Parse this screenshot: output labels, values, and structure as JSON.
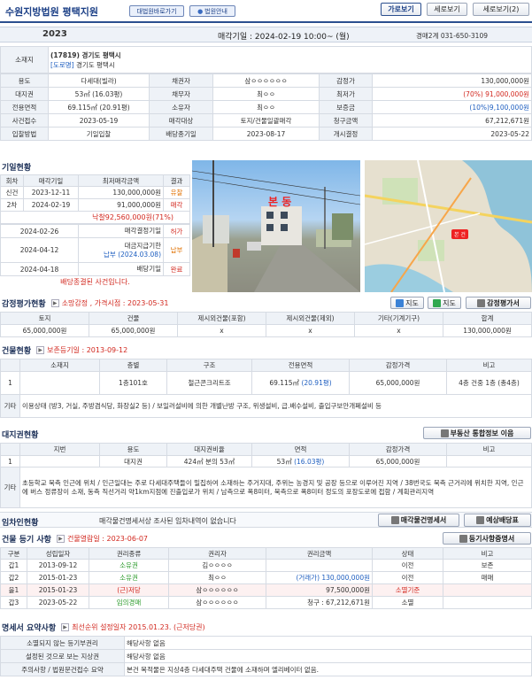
{
  "header": {
    "court": "수원지방법원 평택지원",
    "btn_directions": "대법원바로가기",
    "btn_court_guide": "법원안내",
    "view_horizontal": "가로보기",
    "view_vertical": "세로보기",
    "view_vertical2": "세로보기(2)"
  },
  "case_bar": {
    "year": "2023",
    "sale_date": "매각기일 : 2024-02-19 10:00~ (월)",
    "dept": "경매2계 031-650-3109"
  },
  "summary": {
    "address_label": "소재지",
    "address_zip": "(17819) 경기도 평택시",
    "road_tag": "[도로명]",
    "address_road": "경기도 평택시",
    "rows": [
      [
        "용도",
        "다세대(빌라)",
        "채권자",
        "삼ㅇㅇㅇㅇㅇㅇ",
        "감정가",
        "130,000,000원"
      ],
      [
        "대지권",
        "53㎡ (16.03평)",
        "채무자",
        "최ㅇㅇ",
        "최저가",
        "(70%) 91,000,000원"
      ],
      [
        "전용면적",
        "69.115㎡ (20.91평)",
        "소유자",
        "최ㅇㅇ",
        "보증금",
        "(10%)9,100,000원"
      ],
      [
        "사건접수",
        "2023-05-19",
        "매각대상",
        "토지/건물일괄매각",
        "청구금액",
        "67,212,671원"
      ],
      [
        "입찰방법",
        "기일입찰",
        "배당종기일",
        "2023-08-17",
        "개시결정",
        "2023-05-22"
      ]
    ]
  },
  "auction_history": {
    "title": "기일현황",
    "headers": [
      "회차",
      "매각기일",
      "최저매각금액",
      "결과"
    ],
    "rows": [
      [
        "신건",
        "2023-12-11",
        "130,000,000원",
        "유찰"
      ],
      [
        "2차",
        "2024-02-19",
        "91,000,000원",
        "매각"
      ]
    ],
    "winning_bid": "낙찰92,560,000원(71%)",
    "events": [
      [
        "2024-02-26",
        "매각결정기일",
        "허가"
      ],
      [
        "2024-04-12",
        "대금지급기한",
        "납부"
      ],
      [
        "2024-04-18",
        "배당기일",
        "완료"
      ]
    ],
    "paid_note": "납부 (2024.03.08)",
    "closed_note": "배당종결된 사건입니다."
  },
  "photos": {
    "street_label": "본 동",
    "map_pin": "본 건"
  },
  "map_buttons": {
    "map1": "지도",
    "map2": "지도",
    "appraisal": "감정평가서"
  },
  "appraisal": {
    "title": "감정평가현황",
    "sub": "소망감정 , 가격시점 : 2023-05-31",
    "headers": [
      "토지",
      "건물",
      "제시외건물(포함)",
      "제시외건물(제외)",
      "기타(기계기구)",
      "합계"
    ],
    "values": [
      "65,000,000원",
      "65,000,000원",
      "x",
      "x",
      "x",
      "130,000,000원"
    ]
  },
  "building": {
    "title": "건물현황",
    "sub": "보존등기일 : 2013-09-12",
    "headers": [
      "",
      "소재지",
      "층별",
      "구조",
      "전용면적",
      "감정가격",
      "비고"
    ],
    "row": [
      "1",
      "",
      "1층101호",
      "철근콘크리트조",
      "69.115㎡",
      "(20.91평)",
      "65,000,000원",
      "4층 건중 1층 (총4층)"
    ],
    "etc_label": "기타",
    "etc": "이용상태 (방3, 거실, 주방겸식당, 화장실2 등) / 보일러설비에 의한 개별난방 구조, 위생설비, 급.배수설비, 출입구보안개폐설비 등"
  },
  "land": {
    "title": "대지권현황",
    "button": "부동산 통합정보 이음",
    "headers": [
      "",
      "지번",
      "용도",
      "대지권비율",
      "면적",
      "감정가격",
      "비고"
    ],
    "row": [
      "1",
      "",
      "대지권",
      "424㎡ 분의 53㎡",
      "53㎡",
      "(16.03평)",
      "65,000,000원",
      ""
    ],
    "etc_label": "기타",
    "etc": "초등학교 북측 인근에 위치 / 인근일대는 주로 다세대주택들이 밀집하여 소재하는 주거지대, 주위는 농경지 및 공장 등으로 이루어진 지역 / 38번국도 북측 근거리에 위치한 지역, 인근에 버스 정류장이 소재, 동측 직선거리 약1km지점에 진출입로가 위치 / 남측으로 폭8미터, 북측으로 폭8미터 정도의 포장도로에 접함 / 계획관리지역"
  },
  "tenant": {
    "title": "임차인현황",
    "note": "매각물건명세서상 조사된 임차내역이 없습니다",
    "btn_spec": "매각물건명세서",
    "btn_dividend": "예상배당표"
  },
  "registry": {
    "title": "건물 등기 사항",
    "sub": "건물열람일 : 2023-06-07",
    "button": "등기사항증명서",
    "headers": [
      "구분",
      "성립일자",
      "권리종류",
      "권리자",
      "권리금액",
      "상태",
      "비고"
    ],
    "rows": [
      [
        "갑1",
        "2013-09-12",
        "소유권",
        "김ㅇㅇㅇㅇ",
        "",
        "이전",
        "보존"
      ],
      [
        "갑2",
        "2015-01-23",
        "소유권",
        "최ㅇㅇ",
        "(거래가) 130,000,000원",
        "이전",
        "매매"
      ],
      [
        "을1",
        "2015-01-23",
        "(근)저당",
        "삼ㅇㅇㅇㅇㅇㅇ",
        "97,500,000원",
        "소멸기준",
        ""
      ],
      [
        "갑3",
        "2023-05-22",
        "임의경매",
        "삼ㅇㅇㅇㅇㅇㅇ",
        "청구 : 67,212,671원",
        "소멸",
        ""
      ]
    ]
  },
  "spec_summary": {
    "title": "명세서 요약사항",
    "sub": "최선순위 설정일자 2015.01.23. (근저당권)",
    "rows": [
      [
        "소멸되지 않는 등기부권리",
        "해당사항 없음"
      ],
      [
        "설정된 것으로 보는 지상권",
        "해당사항 없음"
      ],
      [
        "주의사항 / 법원문건접수 요약",
        "본건 목적물은 지상4층 다세대주택 건물에 소재하며 엘리베이터 없음."
      ]
    ]
  }
}
